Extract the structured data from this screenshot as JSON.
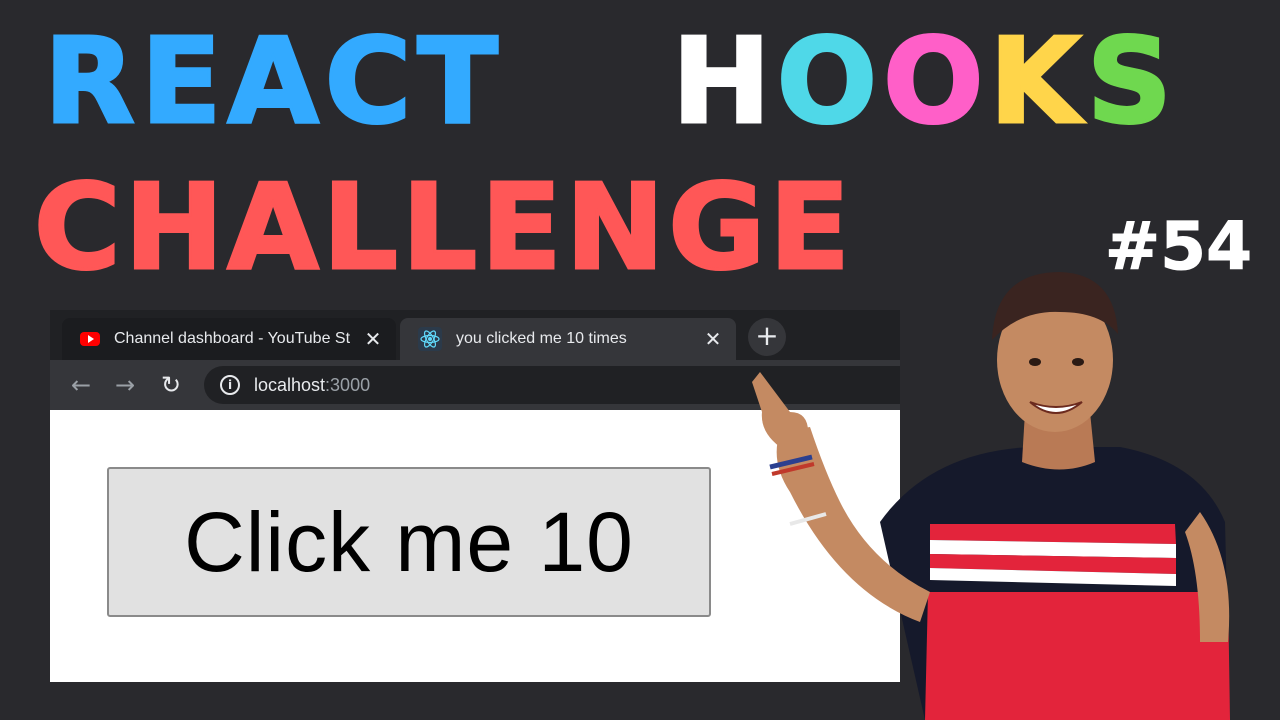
{
  "headline": {
    "react": "REACT",
    "hooks_letters": [
      "H",
      "O",
      "O",
      "K",
      "S"
    ],
    "hooks_colors": [
      "#ffffff",
      "#4fd8e8",
      "#ff5fc8",
      "#ffd54a",
      "#6fd84f"
    ],
    "challenge": "CHALLENGE",
    "episode": "#54"
  },
  "browser": {
    "tabs": [
      {
        "title": "Channel dashboard - YouTube St",
        "icon": "youtube-icon",
        "close": "✕"
      },
      {
        "title": "you clicked me 10 times",
        "icon": "react-icon",
        "close": "✕"
      }
    ],
    "new_tab": "+",
    "nav": {
      "back": "←",
      "forward": "→",
      "reload": "↻"
    },
    "address": {
      "host": "localhost",
      "port": ":3000"
    },
    "page_button_label": "Click me 10"
  },
  "colors": {
    "react": "#33aaff",
    "challenge": "#ff5757",
    "background": "#29292d"
  }
}
